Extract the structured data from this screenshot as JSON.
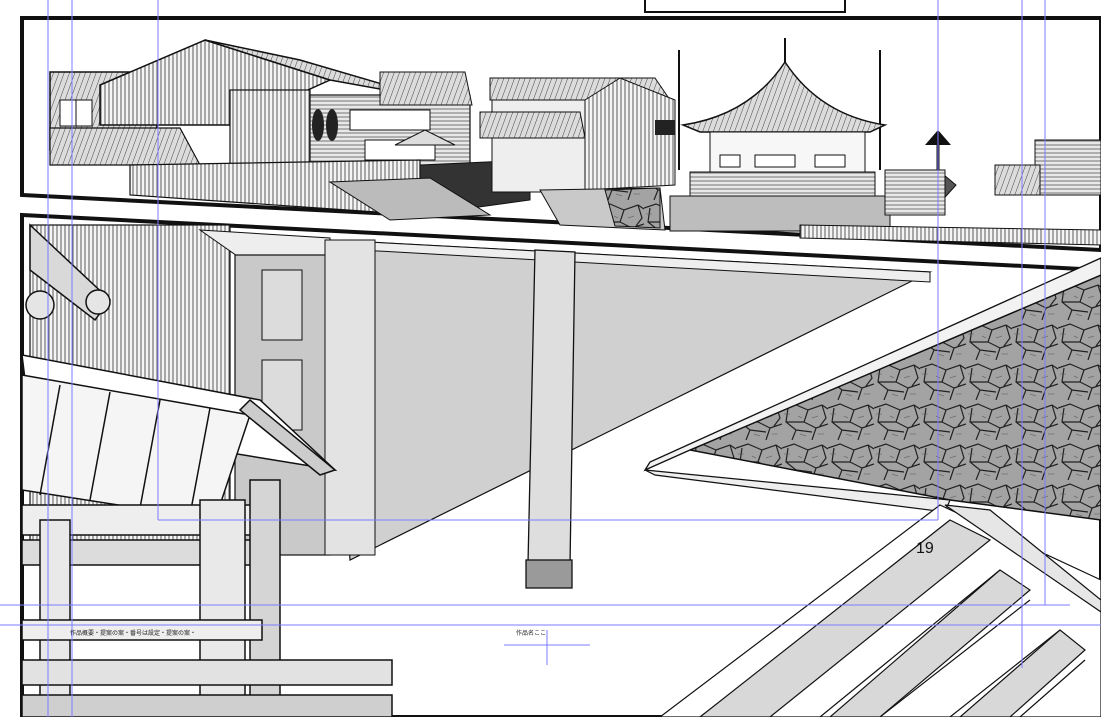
{
  "page": {
    "page_number": "19",
    "bottom_note_left": "作品概要・提案の案・番号は設定・提案の案・",
    "bottom_note_center": "作品名ここ"
  },
  "colors": {
    "ink": "#111111",
    "guide": "#7b7bff",
    "stone": "#9a9a9a"
  }
}
